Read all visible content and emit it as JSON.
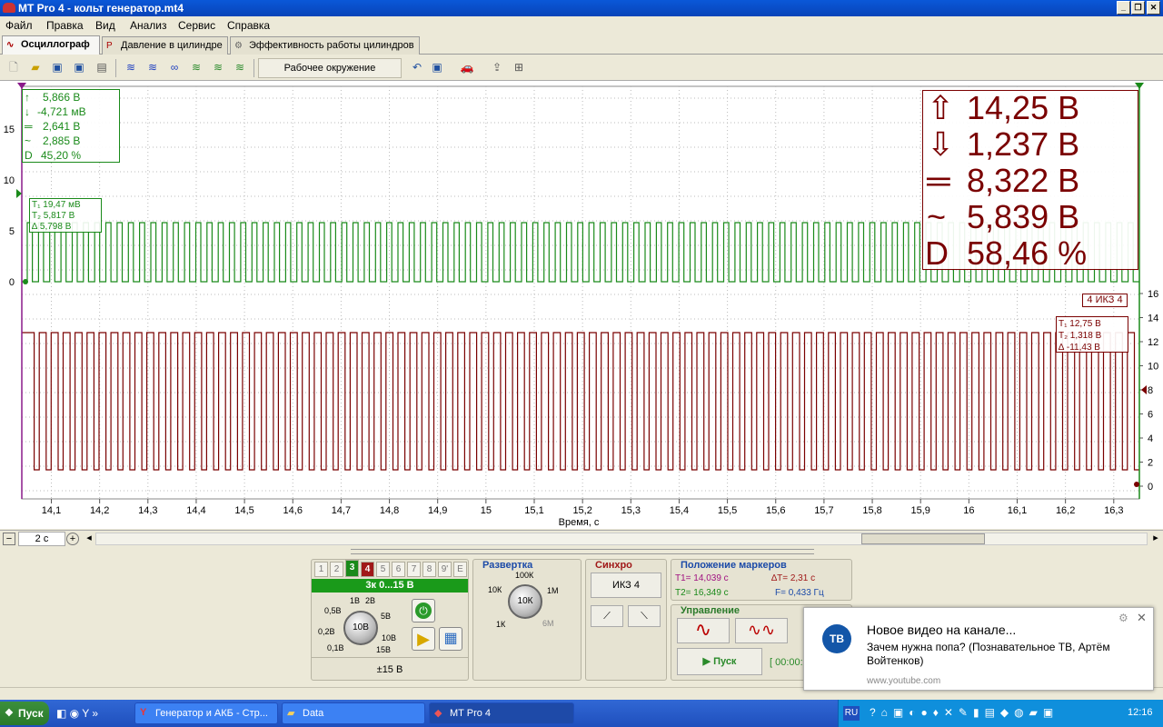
{
  "window": {
    "title": "MT Pro 4 - кольт генератор.mt4"
  },
  "menu": [
    "Файл",
    "Правка",
    "Вид",
    "Анализ",
    "Сервис",
    "Справка"
  ],
  "tabs": [
    "Осциллограф",
    "Давление в цилиндре",
    "Эффективность работы цилиндров"
  ],
  "toolbar": {
    "environment": "Рабочее окружение"
  },
  "plot": {
    "x_axis_label": "Время, с",
    "x_ticks": [
      "14,1",
      "14,2",
      "14,3",
      "14,4",
      "14,5",
      "14,6",
      "14,7",
      "14,8",
      "14,9",
      "15",
      "15,1",
      "15,2",
      "15,3",
      "15,4",
      "15,5",
      "15,6",
      "15,7",
      "15,8",
      "15,9",
      "16",
      "16,1",
      "16,2",
      "16,3"
    ],
    "left_ticks": [
      "15",
      "10",
      "5",
      "0"
    ],
    "right_ticks": [
      "16",
      "14",
      "12",
      "10",
      "8",
      "6",
      "4",
      "2",
      "0"
    ],
    "ch3_stats": {
      "max": "5,866 В",
      "min": "-4,721 мВ",
      "avg": "2,641 В",
      "rms": "2,885 В",
      "duty": "45,20 %"
    },
    "ch3_markers": {
      "t1": "19,47 мВ",
      "t2": "5,817 В",
      "delta": "5,798 В"
    },
    "ch4_label": "4 ИКЗ 4",
    "ch4_markers": {
      "t1": "12,75 В",
      "t2": "1,318 В",
      "delta": "-11,43 В"
    },
    "big_stats": {
      "max": "14,25 В",
      "min": "1,237 В",
      "avg": "8,322 В",
      "rms": "5,839 В",
      "duty_label": "D",
      "duty": "58,46 %"
    },
    "colors": {
      "ch3": "#1a8a1a",
      "ch4": "#7a0000"
    }
  },
  "scroll": {
    "zoom": "2 с"
  },
  "channel_panel": {
    "buttons": [
      "1",
      "2",
      "3",
      "4",
      "5",
      "6",
      "7",
      "8",
      "9'",
      "E"
    ],
    "active": "3",
    "header": "3к 0...15 В",
    "range": "±15 В",
    "knob_center": "10В",
    "knob_labels": [
      "1В",
      "2В",
      "0,5В",
      "5В",
      "0,2В",
      "10В",
      "0,1В",
      "15В"
    ]
  },
  "sweep": {
    "title": "Развертка",
    "knob_center": "10К",
    "labels": [
      "100К",
      "10К",
      "1М",
      "1К",
      "6М"
    ]
  },
  "sync": {
    "title": "Синхро",
    "source": "ИКЗ 4"
  },
  "markers_panel": {
    "title": "Положение маркеров",
    "t1": "T1= 14,039 с",
    "dt": "∆T= 2,31 с",
    "t2": "T2= 16,349 с",
    "f": "F= 0,433 Гц"
  },
  "control": {
    "title": "Управление",
    "start": "Пуск",
    "time": "[ 00:00:"
  },
  "toast": {
    "title": "Новое видео на канале...",
    "text": "Зачем нужна попа? (Познавательное ТВ, Артём Войтенков)",
    "url": "www.youtube.com",
    "logo": "ТВ"
  },
  "taskbar": {
    "start": "Пуск",
    "tasks": [
      "Генератор и АКБ - Стр...",
      "Data",
      "MT Pro 4"
    ],
    "lang": "RU",
    "clock": "12:16"
  }
}
